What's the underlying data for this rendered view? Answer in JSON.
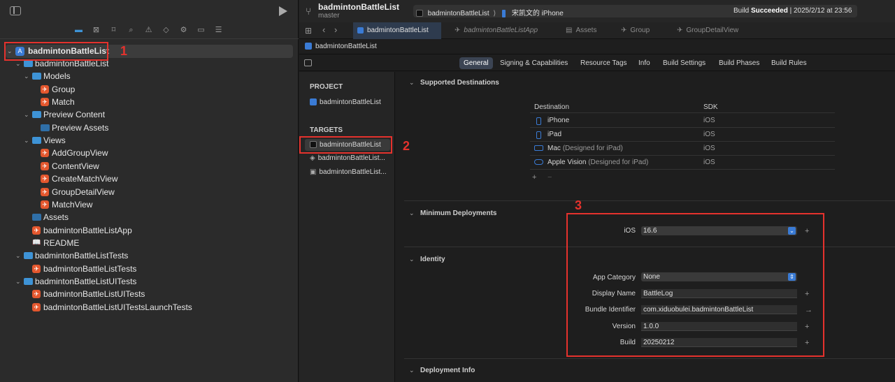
{
  "navigator": {
    "project_name": "badmintonBattleList",
    "tree": [
      {
        "label": "badmintonBattleList",
        "kind": "folder",
        "depth": 1,
        "open": true
      },
      {
        "label": "Models",
        "kind": "folder",
        "depth": 2,
        "open": true
      },
      {
        "label": "Group",
        "kind": "swift",
        "depth": 3
      },
      {
        "label": "Match",
        "kind": "swift",
        "depth": 3
      },
      {
        "label": "Preview Content",
        "kind": "folder",
        "depth": 2,
        "open": true
      },
      {
        "label": "Preview Assets",
        "kind": "assets",
        "depth": 3
      },
      {
        "label": "Views",
        "kind": "folder",
        "depth": 2,
        "open": true
      },
      {
        "label": "AddGroupView",
        "kind": "swift",
        "depth": 3
      },
      {
        "label": "ContentView",
        "kind": "swift",
        "depth": 3
      },
      {
        "label": "CreateMatchView",
        "kind": "swift",
        "depth": 3
      },
      {
        "label": "GroupDetailView",
        "kind": "swift",
        "depth": 3
      },
      {
        "label": "MatchView",
        "kind": "swift",
        "depth": 3
      },
      {
        "label": "Assets",
        "kind": "assets",
        "depth": 2
      },
      {
        "label": "badmintonBattleListApp",
        "kind": "swift",
        "depth": 2
      },
      {
        "label": "README",
        "kind": "book",
        "depth": 2
      },
      {
        "label": "badmintonBattleListTests",
        "kind": "folder",
        "depth": 1,
        "open": true
      },
      {
        "label": "badmintonBattleListTests",
        "kind": "swift",
        "depth": 2
      },
      {
        "label": "badmintonBattleListUITests",
        "kind": "folder",
        "depth": 1,
        "open": true
      },
      {
        "label": "badmintonBattleListUITests",
        "kind": "swift",
        "depth": 2
      },
      {
        "label": "badmintonBattleListUITestsLaunchTests",
        "kind": "swift",
        "depth": 2
      }
    ]
  },
  "annotations": {
    "n1": "1",
    "n2": "2",
    "n3": "3"
  },
  "titlebar": {
    "project": "badmintonBattleList",
    "branch": "master",
    "scheme": "badmintonBattleList",
    "device": "宋凯文的 iPhone",
    "status_prefix": "Build ",
    "status_bold": "Succeeded",
    "status_suffix": " | 2025/2/12 at 23:56"
  },
  "tabs": [
    "badmintonBattleList",
    "badmintonBattleListApp",
    "Assets",
    "Group",
    "GroupDetailView"
  ],
  "jumpbar": {
    "label": "badmintonBattleList"
  },
  "segments": [
    "General",
    "Signing & Capabilities",
    "Resource Tags",
    "Info",
    "Build Settings",
    "Build Phases",
    "Build Rules"
  ],
  "pane": {
    "project_header": "PROJECT",
    "project_item": "badmintonBattleList",
    "targets_header": "TARGETS",
    "targets": [
      "badmintonBattleList",
      "badmintonBattleList...",
      "badmintonBattleList..."
    ]
  },
  "supported": {
    "title": "Supported Destinations",
    "col_dest": "Destination",
    "col_sdk": "SDK",
    "rows": [
      {
        "name": "iPhone",
        "note": "",
        "sdk": "iOS"
      },
      {
        "name": "iPad",
        "note": "",
        "sdk": "iOS"
      },
      {
        "name": "Mac",
        "note": "(Designed for iPad)",
        "sdk": "iOS"
      },
      {
        "name": "Apple Vision",
        "note": "(Designed for iPad)",
        "sdk": "iOS"
      }
    ],
    "add": "+",
    "remove": "−"
  },
  "min_deploy": {
    "title": "Minimum Deployments",
    "ios_label": "iOS",
    "ios_value": "16.6"
  },
  "identity": {
    "title": "Identity",
    "category_label": "App Category",
    "category_value": "None",
    "display_label": "Display Name",
    "display_value": "BattleLog",
    "bundle_label": "Bundle Identifier",
    "bundle_value": "com.xiduobulei.badmintonBattleList",
    "version_label": "Version",
    "version_value": "1.0.0",
    "build_label": "Build",
    "build_value": "20250212"
  },
  "deployment_info": {
    "title": "Deployment Info"
  },
  "colors": {
    "accent": "#3a7bd5",
    "annotation": "#e5322d",
    "success": "#ffffff"
  }
}
